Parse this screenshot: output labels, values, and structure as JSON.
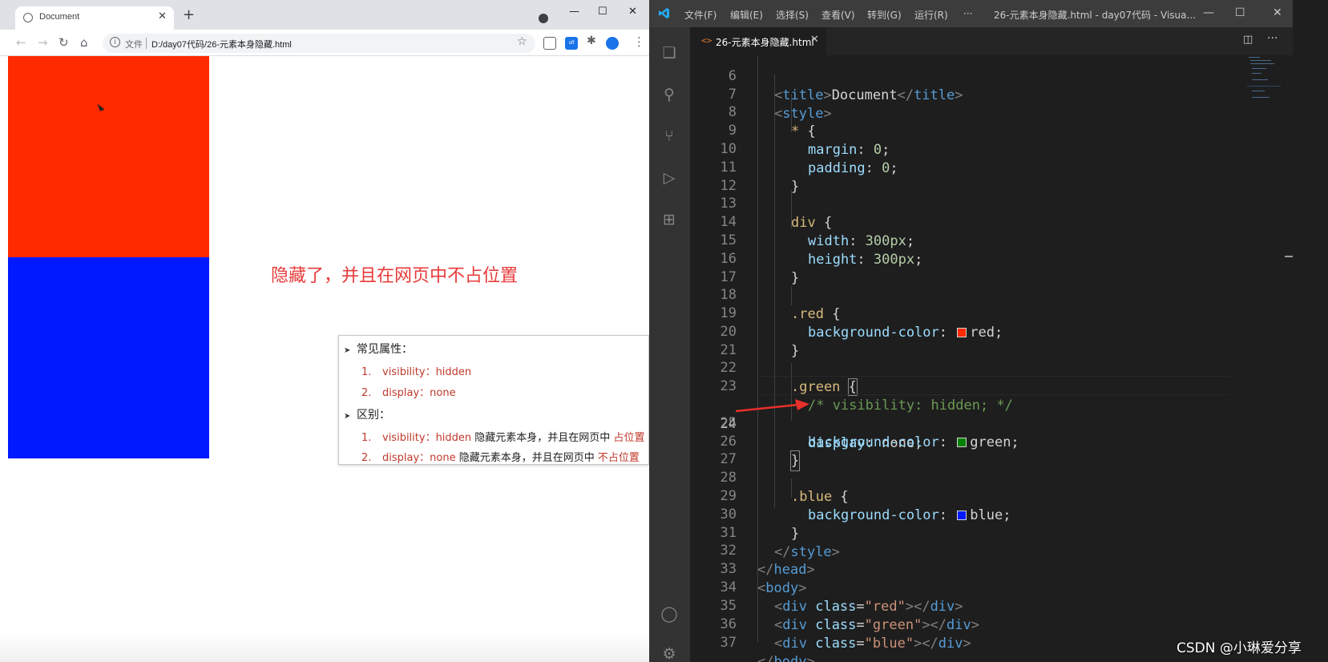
{
  "browser": {
    "tab_title": "Document",
    "tab_close": "✕",
    "new_tab": "+",
    "win_controls": {
      "minimize": "—",
      "maximize": "☐",
      "close": "✕"
    },
    "nav": {
      "back": "←",
      "forward": "→",
      "reload": "↻",
      "home": "⌂"
    },
    "address": {
      "info": "i",
      "scheme_label": "文件",
      "url": "D:/day07代码/26-元素本身隐藏.html"
    },
    "star": "☆",
    "ext_off_label": "off",
    "menu": "⋮",
    "page": {
      "annotation": "隐藏了，并且在网页中不占位置",
      "notes": {
        "heading1": "常见属性：",
        "items1": [
          {
            "num": "1.",
            "text": "visibility：hidden"
          },
          {
            "num": "2.",
            "text": "display：none"
          }
        ],
        "heading2": "区别：",
        "items2": [
          {
            "num": "1.",
            "prop": "visibility：hidden",
            "plain": " 隐藏元素本身，并且在网页中 ",
            "hl": "占位置"
          },
          {
            "num": "2.",
            "prop": "display：none",
            "plain": " 隐藏元素本身，并且在网页中 ",
            "hl": "不占位置"
          }
        ]
      }
    },
    "colors": {
      "red_box": "#ff2a00",
      "blue_box": "#0019ff",
      "annotation": "#e83a3a"
    }
  },
  "vscode": {
    "menu": [
      "文件(F)",
      "编辑(E)",
      "选择(S)",
      "查看(V)",
      "转到(G)",
      "运行(R)",
      "···"
    ],
    "window_title": "26-元素本身隐藏.html - day07代码 - Visua...",
    "win_controls": {
      "minimize": "—",
      "maximize": "☐",
      "close": "✕"
    },
    "tab": {
      "icon": "<>",
      "label": "26-元素本身隐藏.html",
      "close": "✕"
    },
    "activity_icons": [
      "explorer-icon",
      "search-icon",
      "source-control-icon",
      "run-debug-icon",
      "extensions-icon",
      "account-icon",
      "settings-gear-icon"
    ],
    "current_line": "24",
    "lines": [
      {
        "n": "6",
        "code": "<title>Document</title>"
      },
      {
        "n": "7",
        "code": "<style>"
      },
      {
        "n": "8",
        "code": "* {"
      },
      {
        "n": "9",
        "code": "margin: 0;"
      },
      {
        "n": "10",
        "code": "padding: 0;"
      },
      {
        "n": "11",
        "code": "}"
      },
      {
        "n": "12",
        "code": ""
      },
      {
        "n": "13",
        "code": "div {"
      },
      {
        "n": "14",
        "code": "width: 300px;"
      },
      {
        "n": "15",
        "code": "height: 300px;"
      },
      {
        "n": "16",
        "code": "}"
      },
      {
        "n": "17",
        "code": ""
      },
      {
        "n": "18",
        "code": ".red {"
      },
      {
        "n": "19",
        "code": "background-color: red;"
      },
      {
        "n": "20",
        "code": "}"
      },
      {
        "n": "21",
        "code": ""
      },
      {
        "n": "22",
        "code": ".green {"
      },
      {
        "n": "23",
        "code": "/* visibility: hidden; */"
      },
      {
        "n": "24",
        "code": "display: none;"
      },
      {
        "n": "25",
        "code": "background-color: green;"
      },
      {
        "n": "26",
        "code": "}"
      },
      {
        "n": "27",
        "code": ""
      },
      {
        "n": "28",
        "code": ".blue {"
      },
      {
        "n": "29",
        "code": "background-color: blue;"
      },
      {
        "n": "30",
        "code": "}"
      },
      {
        "n": "31",
        "code": "</style>"
      },
      {
        "n": "32",
        "code": "</head>"
      },
      {
        "n": "33",
        "code": "<body>"
      },
      {
        "n": "34",
        "code": "<div class=\"red\"></div>"
      },
      {
        "n": "35",
        "code": "<div class=\"green\"></div>"
      },
      {
        "n": "36",
        "code": "<div class=\"blue\"></div>"
      },
      {
        "n": "37",
        "code": "</body>"
      }
    ],
    "swatch_colors": {
      "red": "#ff2a00",
      "green": "#008000",
      "blue": "#0019ff"
    }
  },
  "watermark": "CSDN @小琳爱分享"
}
